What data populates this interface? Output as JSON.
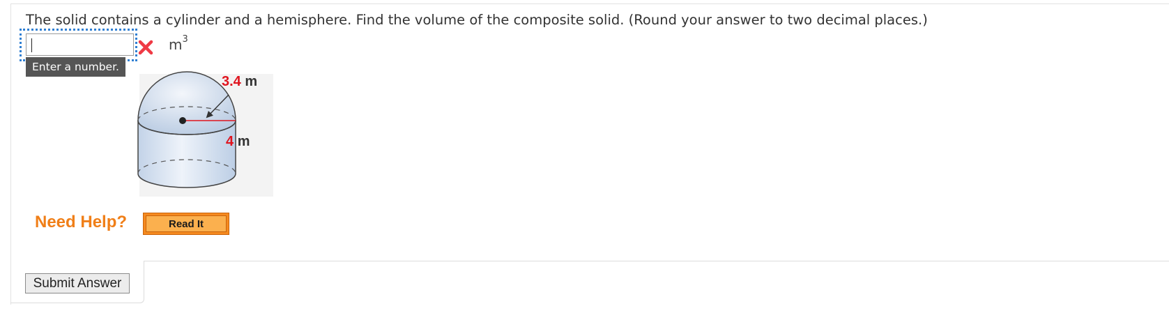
{
  "question": {
    "text": "The solid contains a cylinder and a hemisphere. Find the volume of the composite solid. (Round your answer to two decimal places.)"
  },
  "answer": {
    "value": "",
    "unit_base": "m",
    "unit_exponent": "3",
    "status_icon": "incorrect-x-icon",
    "tooltip": "Enter a number."
  },
  "figure": {
    "radius_value": "3.4",
    "height_value": "4",
    "unit": "m",
    "label_color": "#e0141e"
  },
  "help": {
    "label": "Need Help?",
    "read_it_button": "Read It"
  },
  "submit": {
    "label": "Submit Answer"
  },
  "colors": {
    "help_orange": "#f07f18",
    "focus_blue": "#2f7fd3",
    "error_red": "#ef3a45"
  }
}
